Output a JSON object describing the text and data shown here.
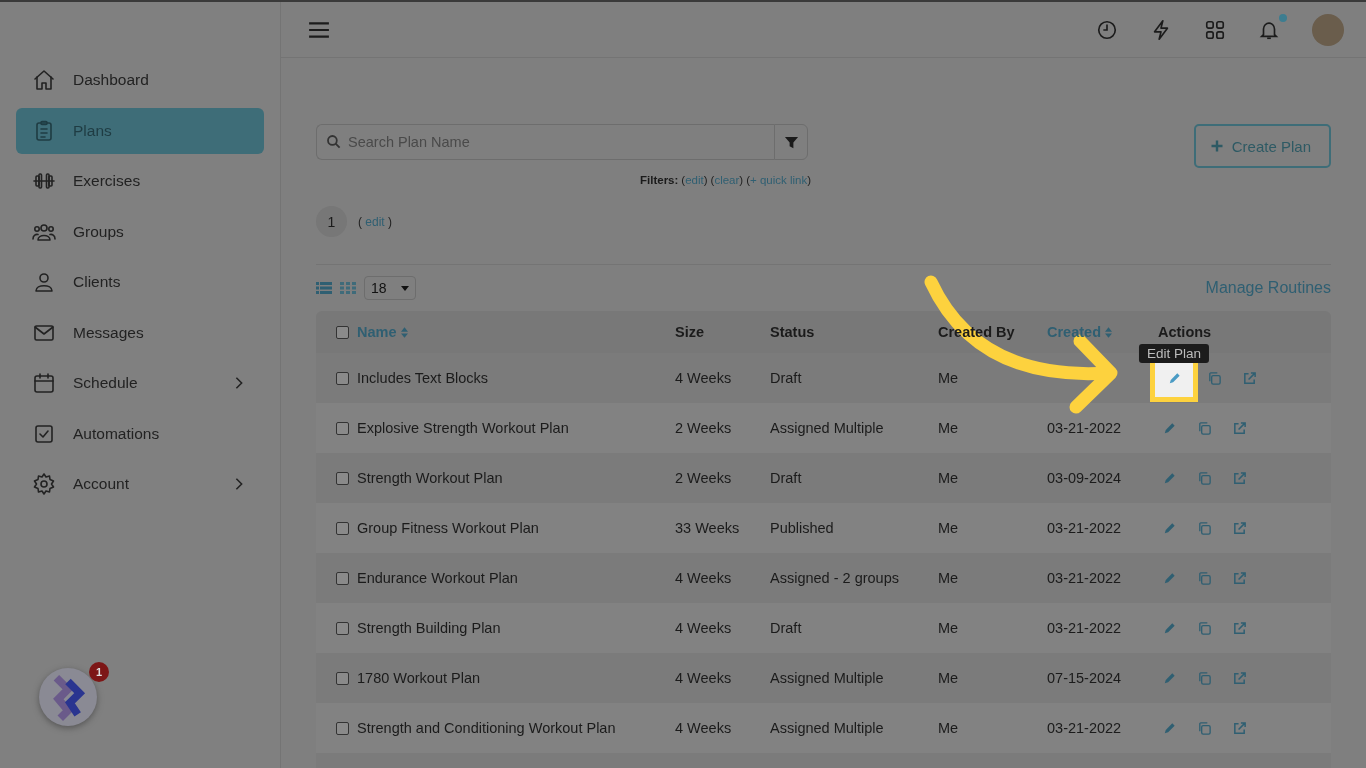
{
  "topbar": {
    "notification_dot": true
  },
  "sidebar": {
    "items": [
      {
        "label": "Dashboard",
        "selected": false,
        "submenu": false
      },
      {
        "label": "Plans",
        "selected": true,
        "submenu": false
      },
      {
        "label": "Exercises",
        "selected": false,
        "submenu": false
      },
      {
        "label": "Groups",
        "selected": false,
        "submenu": false
      },
      {
        "label": "Clients",
        "selected": false,
        "submenu": false
      },
      {
        "label": "Messages",
        "selected": false,
        "submenu": false
      },
      {
        "label": "Schedule",
        "selected": false,
        "submenu": true
      },
      {
        "label": "Automations",
        "selected": false,
        "submenu": false
      },
      {
        "label": "Account",
        "selected": false,
        "submenu": true
      }
    ]
  },
  "launcher": {
    "badge": "1"
  },
  "search": {
    "placeholder": "Search Plan Name"
  },
  "create_button": "Create Plan",
  "filters": {
    "label": "Filters:",
    "links": [
      "(edit)",
      "(clear)",
      "(+ quick link)"
    ]
  },
  "pagination": {
    "page": "1",
    "edit_link": "( edit )"
  },
  "page_size": "18",
  "manage_link": "Manage Routines",
  "table": {
    "select_all_checked": false,
    "columns": [
      {
        "label": "Name",
        "sortable": true
      },
      {
        "label": "Size",
        "sortable": false
      },
      {
        "label": "Status",
        "sortable": false
      },
      {
        "label": "Created By",
        "sortable": false
      },
      {
        "label": "Created",
        "sortable": true
      },
      {
        "label": "Actions",
        "sortable": false
      }
    ],
    "rows": [
      {
        "name": "Includes Text Blocks",
        "size": "4 Weeks",
        "status": "Draft",
        "created_by": "Me",
        "checked": false,
        "tooltip": "Edit Plan"
      },
      {
        "name": "Explosive Strength Workout Plan",
        "size": "2 Weeks",
        "status": "Assigned Multiple",
        "created_by": "Me",
        "created": "03-21-2022",
        "checked": false
      },
      {
        "name": "Strength Workout Plan",
        "size": "2 Weeks",
        "status": "Draft",
        "created_by": "Me",
        "created": "03-09-2024",
        "checked": false
      },
      {
        "name": "Group Fitness Workout Plan",
        "size": "33 Weeks",
        "status": "Published",
        "created_by": "Me",
        "created": "03-21-2022",
        "checked": false
      },
      {
        "name": "Endurance Workout Plan",
        "size": "4 Weeks",
        "status": "Assigned - 2 groups",
        "created_by": "Me",
        "created": "03-21-2022",
        "checked": false
      },
      {
        "name": "Strength Building Plan",
        "size": "4 Weeks",
        "status": "Draft",
        "created_by": "Me",
        "created": "03-21-2022",
        "checked": false
      },
      {
        "name": "1780 Workout Plan",
        "size": "4 Weeks",
        "status": "Assigned Multiple",
        "created_by": "Me",
        "created": "07-15-2024",
        "checked": false
      },
      {
        "name": "Strength and Conditioning Workout Plan",
        "size": "4 Weeks",
        "status": "Assigned Multiple",
        "created_by": "Me",
        "created": "03-21-2022",
        "checked": false
      }
    ]
  }
}
